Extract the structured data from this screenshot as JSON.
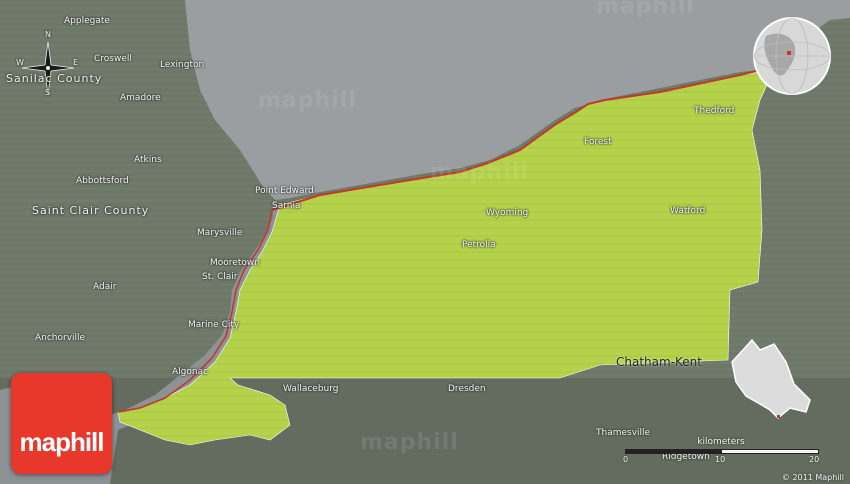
{
  "map": {
    "watermarks": [
      "maphill",
      "maphill",
      "maphill",
      "maphill"
    ],
    "colors": {
      "land_grey": "#6d7868",
      "region_green": "#b4d24a",
      "water": "#9a9ea0",
      "border_red": "#c0392b",
      "logo_red": "#e8372b"
    }
  },
  "compass": {
    "n": "N",
    "s": "S",
    "e": "E",
    "w": "W"
  },
  "counties": {
    "sanilac": "Sanilac County",
    "saint_clair": "Saint Clair County"
  },
  "places_outside": {
    "applegate": "Applegate",
    "croswell": "Croswell",
    "lexington": "Lexington",
    "amadore": "Amadore",
    "atkins": "Atkins",
    "abbottsford": "Abbottsford",
    "marysville": "Marysville",
    "st_clair": "St. Clair",
    "adair": "Adair",
    "marine_city": "Marine City",
    "anchorville": "Anchorville",
    "algonac": "Algonac",
    "wallaceburg": "Wallaceburg",
    "dresden": "Dresden",
    "thamesville": "Thamesville",
    "ridgetown": "Ridgetown"
  },
  "places_inside": {
    "point_edward": "Point Edward",
    "sarnia": "Sarnia",
    "mooretown": "Mooretown",
    "forest": "Forest",
    "thedford": "Thedford",
    "wyoming": "Wyoming",
    "watford": "Watford",
    "petrolia": "Petrolia"
  },
  "neighbor": {
    "chatham_kent": "Chatham-Kent"
  },
  "scale": {
    "unit": "kilometers",
    "ticks": [
      "0",
      "10",
      "20"
    ]
  },
  "logo": {
    "text": "maphill"
  },
  "copyright": "© 2011 Maphill"
}
